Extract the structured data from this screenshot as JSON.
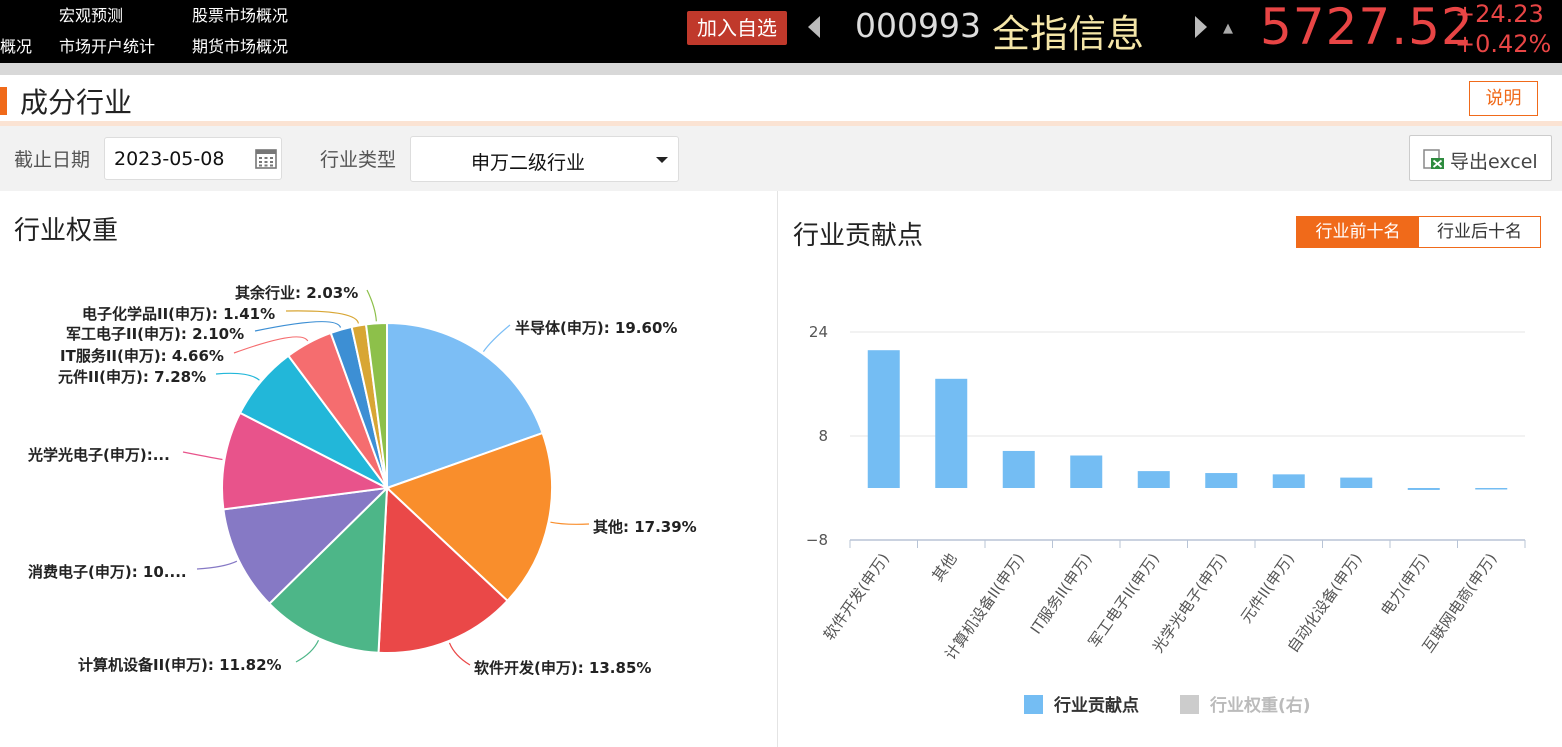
{
  "header": {
    "nav": {
      "r1c1": "宏观预测",
      "r1c2": "股票市场概况",
      "r2c0": "概况",
      "r2c1": "市场开户统计",
      "r2c2": "期货市场概况"
    },
    "add_watchlist": "加入自选",
    "code": "000993",
    "name": "全指信息",
    "price": "5727.52",
    "change": "+24.23",
    "change_pct": "+0.42%"
  },
  "section": {
    "title": "成分行业",
    "explain": "说明"
  },
  "filters": {
    "date_label": "截止日期",
    "date_value": "2023-05-08",
    "type_label": "行业类型",
    "type_value": "申万二级行业",
    "export_label": "导出excel"
  },
  "weight_panel": {
    "title": "行业权重"
  },
  "contrib_panel": {
    "title": "行业贡献点",
    "tabs": [
      "行业前十名",
      "行业后十名"
    ]
  },
  "chart_data": [
    {
      "type": "pie",
      "slices": [
        {
          "label": "半导体(申万)",
          "value": 19.6,
          "display": "半导体(申万): 19.60%",
          "color": "#7cbef5"
        },
        {
          "label": "其他",
          "value": 17.39,
          "display": "其他: 17.39%",
          "color": "#f98e2c"
        },
        {
          "label": "软件开发(申万)",
          "value": 13.85,
          "display": "软件开发(申万): 13.85%",
          "color": "#ea4848"
        },
        {
          "label": "计算机设备II(申万)",
          "value": 11.82,
          "display": "计算机设备II(申万): 11.82%",
          "color": "#4db688"
        },
        {
          "label": "消费电子(申万)",
          "value": 10.3,
          "display": "消费电子(申万): 10....",
          "color": "#8679c5"
        },
        {
          "label": "光学光电子(申万)",
          "value": 9.6,
          "display": "光学光电子(申万):...",
          "color": "#e8538b"
        },
        {
          "label": "元件II(申万)",
          "value": 7.28,
          "display": "元件II(申万): 7.28%",
          "color": "#22b7d9"
        },
        {
          "label": "IT服务II(申万)",
          "value": 4.66,
          "display": "IT服务II(申万): 4.66%",
          "color": "#f56d6f"
        },
        {
          "label": "军工电子II(申万)",
          "value": 2.1,
          "display": "军工电子II(申万): 2.10%",
          "color": "#3d8fd4"
        },
        {
          "label": "电子化学品II(申万)",
          "value": 1.41,
          "display": "电子化学品II(申万): 1.41%",
          "color": "#d8a634"
        },
        {
          "label": "其余行业",
          "value": 2.03,
          "display": "其余行业: 2.03%",
          "color": "#8dc04a"
        }
      ]
    },
    {
      "type": "bar",
      "categories": [
        "软件开发(申万)",
        "其他",
        "计算机设备II(申万)",
        "IT服务II(申万)",
        "军工电子II(申万)",
        "光学光电子(申万)",
        "元件II(申万)",
        "自动化设备(申万)",
        "电力(申万)",
        "互联网电商(申万)"
      ],
      "series": [
        {
          "name": "行业贡献点",
          "values": [
            21.2,
            16.8,
            5.7,
            5.0,
            2.6,
            2.3,
            2.1,
            1.6,
            -0.3,
            -0.2
          ],
          "color": "#74bdf3"
        },
        {
          "name": "行业权重(右)",
          "values": [],
          "color": "#cccccc"
        }
      ],
      "y_ticks": [
        "24",
        "8",
        "−8"
      ],
      "ylim": [
        -8,
        24
      ],
      "grid": true,
      "legend": "bottom"
    }
  ]
}
